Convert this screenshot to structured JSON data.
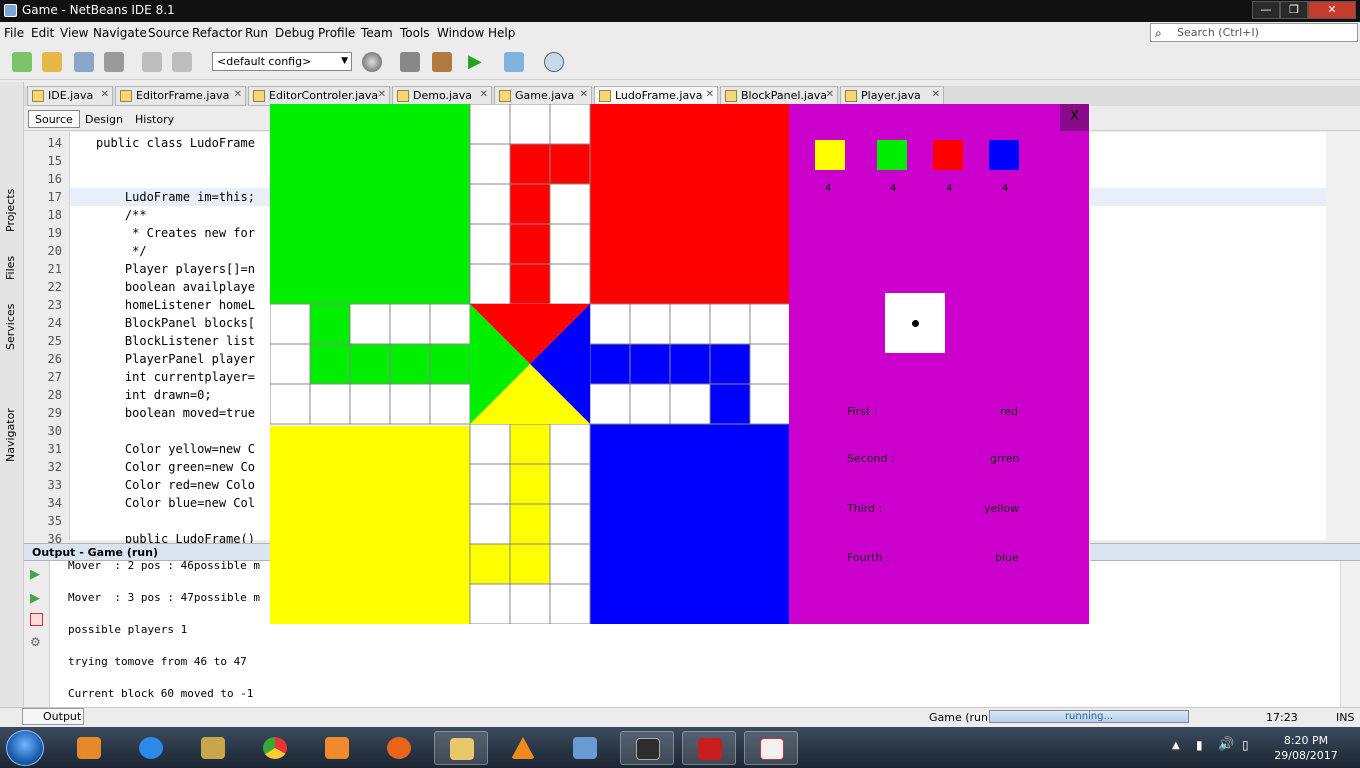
{
  "window": {
    "title": "Game - NetBeans IDE 8.1",
    "controls": [
      "—",
      "❐",
      "✕"
    ]
  },
  "menu": [
    "File",
    "Edit",
    "View",
    "Navigate",
    "Source",
    "Refactor",
    "Run",
    "Debug",
    "Profile",
    "Team",
    "Tools",
    "Window",
    "Help"
  ],
  "search": {
    "placeholder": "Search (Ctrl+I)"
  },
  "toolbar": {
    "config": "<default config>"
  },
  "left_rail": [
    "Projects",
    "Files",
    "Services",
    "Navigator"
  ],
  "editor_tabs": [
    "IDE.java",
    "EditorFrame.java",
    "EditorControler.java",
    "Demo.java",
    "Game.java",
    "LudoFrame.java",
    "BlockPanel.java",
    "Player.java"
  ],
  "active_tab": "LudoFrame.java",
  "view_tabs": [
    "Source",
    "Design",
    "History"
  ],
  "code_lines": [
    {
      "n": "14",
      "t": "public class LudoFrame"
    },
    {
      "n": "15",
      "t": ""
    },
    {
      "n": "16",
      "t": ""
    },
    {
      "n": "17",
      "t": "    LudoFrame im=this;"
    },
    {
      "n": "18",
      "t": "    /**"
    },
    {
      "n": "19",
      "t": "     * Creates new for"
    },
    {
      "n": "20",
      "t": "     */"
    },
    {
      "n": "21",
      "t": "    Player players[]=n"
    },
    {
      "n": "22",
      "t": "    boolean availplaye"
    },
    {
      "n": "23",
      "t": "    homeListener homeL"
    },
    {
      "n": "24",
      "t": "    BlockPanel blocks["
    },
    {
      "n": "25",
      "t": "    BlockListener list"
    },
    {
      "n": "26",
      "t": "    PlayerPanel player"
    },
    {
      "n": "27",
      "t": "    int currentplayer="
    },
    {
      "n": "28",
      "t": "    int drawn=0;"
    },
    {
      "n": "29",
      "t": "    boolean moved=true"
    },
    {
      "n": "30",
      "t": ""
    },
    {
      "n": "31",
      "t": "    Color yellow=new C"
    },
    {
      "n": "32",
      "t": "    Color green=new Co"
    },
    {
      "n": "33",
      "t": "    Color red=new Colo"
    },
    {
      "n": "34",
      "t": "    Color blue=new Col"
    },
    {
      "n": "35",
      "t": ""
    },
    {
      "n": "36",
      "t": "    public LudoFrame()"
    }
  ],
  "output": {
    "title": "Output - Game (run)",
    "lines": [
      "Mover  : 2 pos : 46possible m",
      "Mover  : 3 pos : 47possible m",
      "possible players 1",
      "trying tomove from 46 to 47",
      "Current block 60 moved to -1"
    ]
  },
  "status": {
    "output_tab": "Output",
    "run_label": "Game (run)",
    "progress_text": "running...",
    "position": "17:23",
    "mode": "INS"
  },
  "taskbar": {
    "time": "8:20 PM",
    "date": "29/08/2017"
  },
  "ludo": {
    "close_label": "X",
    "player_counts": [
      {
        "color": "#ffff00",
        "count": "4"
      },
      {
        "color": "#00ee00",
        "count": "4"
      },
      {
        "color": "#ff0000",
        "count": "4"
      },
      {
        "color": "#0000ff",
        "count": "4"
      }
    ],
    "ranking": [
      {
        "label": "First   :",
        "value": "red"
      },
      {
        "label": "Second :",
        "value": "grren"
      },
      {
        "label": "Third  :",
        "value": "yellow"
      },
      {
        "label": "Fourth :",
        "value": "blue"
      }
    ],
    "colors": {
      "green": "#00ee00",
      "red": "#ff0000",
      "yellow": "#ffff00",
      "blue": "#0000ff",
      "panel": "#cc00cc"
    }
  }
}
